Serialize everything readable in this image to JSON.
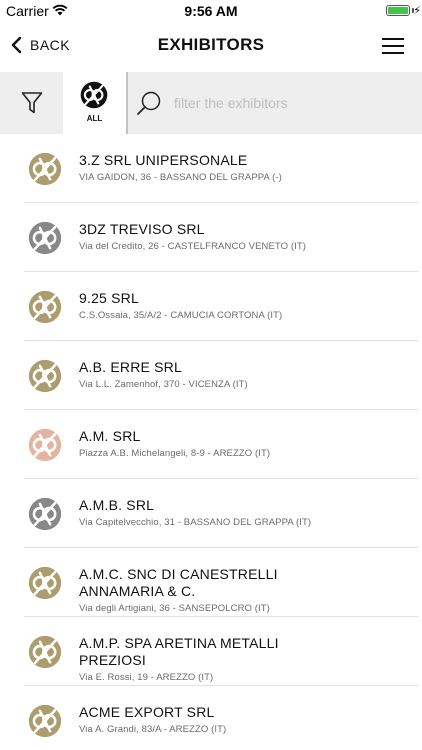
{
  "status": {
    "carrier": "Carrier",
    "time": "9:56 AM"
  },
  "nav": {
    "back_label": "BACK",
    "title": "EXHIBITORS"
  },
  "toolbar": {
    "all_label": "ALL",
    "search_placeholder": "filter the exhibitors"
  },
  "colors": {
    "gold": "#ad9d6e",
    "grey": "#888888",
    "rose": "#e4b4a2",
    "black": "#111111"
  },
  "exhibitors": [
    {
      "name": "3.Z SRL UNIPERSONALE",
      "address": "VIA GAIDON, 36 - BASSANO DEL GRAPPA (-)",
      "badge": "gold"
    },
    {
      "name": "3DZ TREVISO SRL",
      "address": "Via del Credito, 26 - CASTELFRANCO VENETO (IT)",
      "badge": "grey"
    },
    {
      "name": "9.25 SRL",
      "address": "C.S.Ossaia, 35/A/2 - CAMUCIA CORTONA (IT)",
      "badge": "gold"
    },
    {
      "name": "A.B. ERRE SRL",
      "address": "Via L.L. Zamenhof, 370 - VICENZA (IT)",
      "badge": "gold"
    },
    {
      "name": "A.M. SRL",
      "address": "Piazza A.B. Michelangeli, 8-9 - AREZZO (IT)",
      "badge": "rose"
    },
    {
      "name": "A.M.B. SRL",
      "address": "Via Capitelvecchio, 31 - BASSANO DEL GRAPPA (IT)",
      "badge": "grey"
    },
    {
      "name": "A.M.C. SNC DI CANESTRELLI ANNAMARIA & C.",
      "address": "Via degli Artigiani, 36 - SANSEPOLCRO (IT)",
      "badge": "gold"
    },
    {
      "name": "A.M.P. SPA ARETINA METALLI PREZIOSI",
      "address": "Via E. Rossi, 19 - AREZZO (IT)",
      "badge": "gold"
    },
    {
      "name": "ACME EXPORT SRL",
      "address": "Via A. Grandi, 83/A - AREZZO (IT)",
      "badge": "gold"
    }
  ]
}
